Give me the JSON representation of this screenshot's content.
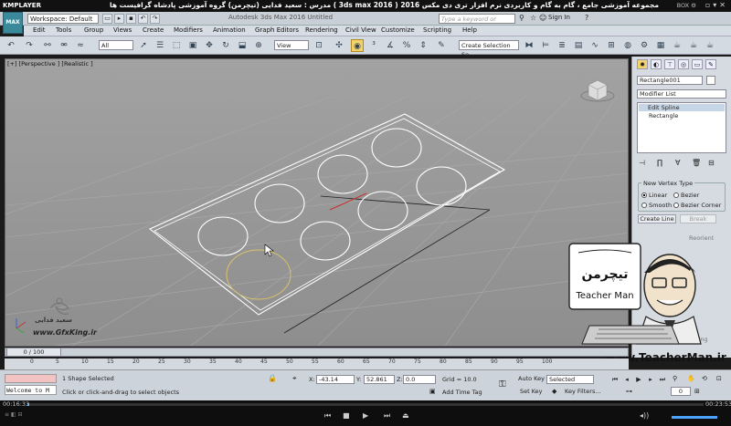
{
  "player": {
    "name": "KMPLAYER",
    "title": "مجموعه آموزشی جامع ، گام به گام و کاربردی نرم افزار تری دی مکس 2016 ( 3ds max 2016 )  مدرس : سعید فدایی (تیچرمن) گروه آموزشی پادشاه گرافیست ها",
    "box_label": "BOX ⚙",
    "time_current": "00:16:33",
    "time_total": "00:23:53",
    "progress": 0.0
  },
  "max": {
    "logo": "MAX",
    "workspace": "Workspace: Default",
    "app_title": "Autodesk 3ds Max 2016     Untitled",
    "search_placeholder": "Type a keyword or phrase",
    "signin": "Sign In",
    "menus": [
      "Edit",
      "Tools",
      "Group",
      "Views",
      "Create",
      "Modifiers",
      "Animation",
      "Graph Editors",
      "Rendering",
      "Civil View",
      "Customize",
      "Scripting",
      "Help"
    ],
    "toolbar": {
      "filter": "All",
      "refcoord": "View",
      "selset": "Create Selection Se"
    },
    "viewport_label": "[+] [Perspective ] [Realistic ]",
    "cmd": {
      "object_name": "Rectangle001",
      "modifier_list": "Modifier List",
      "stack_top": "Edit Spline",
      "stack_base": "Rectangle",
      "rollout_title": "New Vertex Type",
      "radio_linear": "Linear",
      "radio_bezier": "Bezier",
      "radio_smooth": "Smooth",
      "radio_bezier_corner": "Bezier Corner",
      "create_line": "Create Line",
      "break": "Break",
      "reorient": "Reorient",
      "binding": "Binding"
    },
    "timeslider": "0 / 100",
    "ticks": [
      "0",
      "5",
      "10",
      "15",
      "20",
      "25",
      "30",
      "35",
      "40",
      "45",
      "50",
      "55",
      "60",
      "65",
      "70",
      "75",
      "80",
      "85",
      "90",
      "95",
      "100"
    ],
    "status": {
      "maxscript_welcome": "Welcome to M",
      "selected": "1 Shape Selected",
      "prompt": "Click or click-and-drag to select objects",
      "x_label": "X:",
      "x_value": "-43.14",
      "y_label": "Y:",
      "y_value": "52.861",
      "z_label": "Z:",
      "z_value": "0.0",
      "grid": "Grid = 10.0",
      "add_time_tag": "Add Time Tag",
      "auto_key": "Auto Key",
      "set_key": "Set Key",
      "selected_combo": "Selected",
      "key_filters": "Key Filters...",
      "frame": "0"
    }
  },
  "watermarks": {
    "gfx_name": "سعید فدایی",
    "gfx_url": "www.GfxKing.ir",
    "teacher_url": "www.TeacherMan.ir",
    "teacher_brand": "Teacher Man",
    "teacher_persian": "تیچرمن"
  }
}
